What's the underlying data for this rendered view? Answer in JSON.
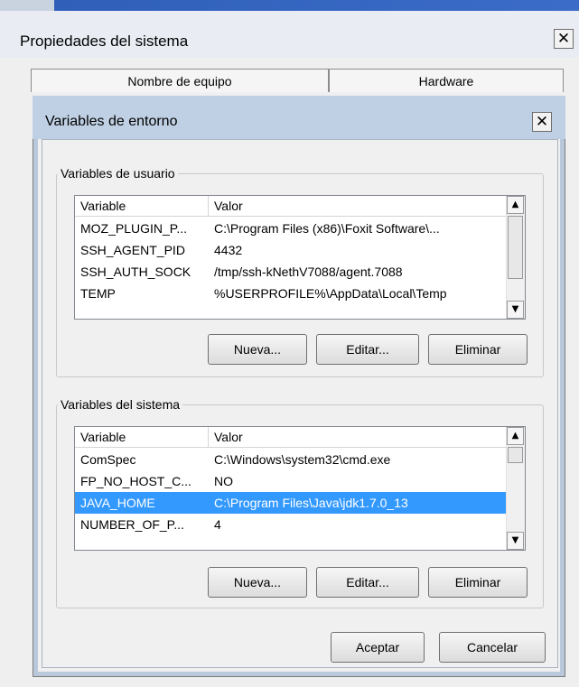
{
  "parent_window": {
    "title": "Propiedades del sistema",
    "close_glyph": "✕",
    "tabs": [
      {
        "label": "Nombre de equipo"
      },
      {
        "label": "Hardware"
      }
    ]
  },
  "dialog": {
    "title": "Variables de entorno",
    "close_glyph": "✕",
    "user_vars": {
      "legend": "Variables de usuario",
      "columns": [
        "Variable",
        "Valor"
      ],
      "rows": [
        {
          "name": "MOZ_PLUGIN_P...",
          "value": "C:\\Program Files (x86)\\Foxit Software\\..."
        },
        {
          "name": "SSH_AGENT_PID",
          "value": "4432"
        },
        {
          "name": "SSH_AUTH_SOCK",
          "value": "/tmp/ssh-kNethV7088/agent.7088"
        },
        {
          "name": "TEMP",
          "value": "%USERPROFILE%\\AppData\\Local\\Temp"
        }
      ],
      "buttons": {
        "new": "Nueva...",
        "edit": "Editar...",
        "delete": "Eliminar"
      }
    },
    "system_vars": {
      "legend": "Variables del sistema",
      "columns": [
        "Variable",
        "Valor"
      ],
      "rows": [
        {
          "name": "ComSpec",
          "value": "C:\\Windows\\system32\\cmd.exe"
        },
        {
          "name": "FP_NO_HOST_C...",
          "value": "NO"
        },
        {
          "name": "JAVA_HOME",
          "value": "C:\\Program Files\\Java\\jdk1.7.0_13",
          "selected": true
        },
        {
          "name": "NUMBER_OF_P...",
          "value": "4"
        }
      ],
      "buttons": {
        "new": "Nueva...",
        "edit": "Editar...",
        "delete": "Eliminar"
      }
    },
    "footer": {
      "ok": "Aceptar",
      "cancel": "Cancelar"
    }
  },
  "scroll": {
    "up_glyph": "▲",
    "down_glyph": "▼"
  }
}
